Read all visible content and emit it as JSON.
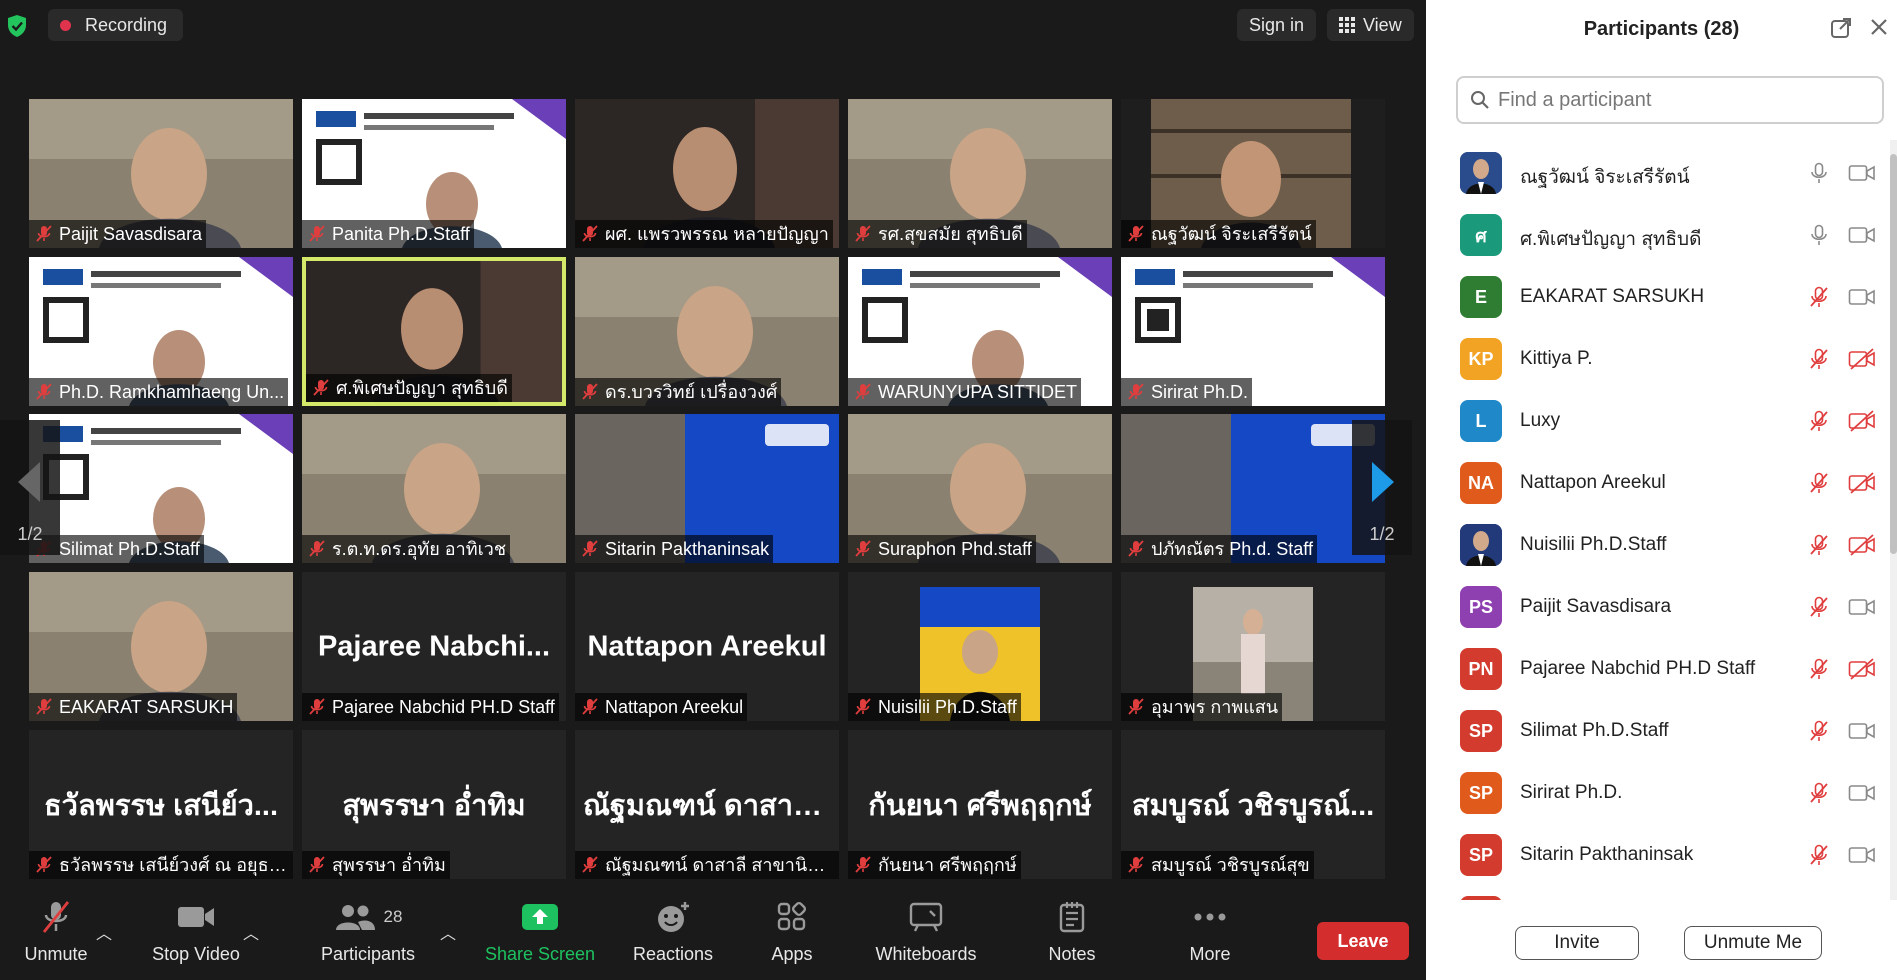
{
  "topbar": {
    "recording": "Recording",
    "sign_in": "Sign in",
    "view": "View"
  },
  "tiles": [
    {
      "name": "Paijit Savasdisara",
      "scene": "person",
      "big": ""
    },
    {
      "name": "Panita Ph.D.Staff",
      "scene": "slide-person",
      "big": ""
    },
    {
      "name": "ผศ. แพรวพรรณ หลายปัญญา",
      "scene": "person-dark",
      "big": ""
    },
    {
      "name": "รศ.สุขสมัย สุทธิบดี",
      "scene": "person",
      "big": ""
    },
    {
      "name": "ณฐวัฒน์ จิระเสรีรัตน์",
      "scene": "bookshelf",
      "big": ""
    },
    {
      "name": "Ph.D. Ramkhamhaeng Un...",
      "scene": "slide-person",
      "big": ""
    },
    {
      "name": "ศ.พิเศษปัญญา สุทธิบดี",
      "scene": "person-dark",
      "big": "",
      "active": true
    },
    {
      "name": "ดร.บวรวิทย์ เปรื่องวงศ์",
      "scene": "person",
      "big": ""
    },
    {
      "name": "WARUNYUPA SITTIDET",
      "scene": "slide-person",
      "big": ""
    },
    {
      "name": "Sirirat Ph.D.",
      "scene": "slide",
      "big": ""
    },
    {
      "name": "Silimat Ph.D.Staff",
      "scene": "slide-person",
      "big": ""
    },
    {
      "name": "ร.ต.ท.ดร.อุทัย อาทิเวช",
      "scene": "person",
      "big": ""
    },
    {
      "name": "Sitarin Pakthaninsak",
      "scene": "phd-blue",
      "big": ""
    },
    {
      "name": "Suraphon Phd.staff",
      "scene": "person",
      "big": ""
    },
    {
      "name": "ปภัทณัตร Ph.d. Staff",
      "scene": "phd-blue",
      "big": ""
    },
    {
      "name": "EAKARAT SARSUKH",
      "scene": "person",
      "big": ""
    },
    {
      "name": "Pajaree Nabchid PH.D Staff",
      "scene": "blank",
      "big": "Pajaree  Nabchi..."
    },
    {
      "name": "Nattapon Areekul",
      "scene": "blank",
      "big": "Nattapon Areekul"
    },
    {
      "name": "Nuisilii Ph.D.Staff",
      "scene": "phd-yellow",
      "big": ""
    },
    {
      "name": "อุมาพร กาพแสน",
      "scene": "photo",
      "big": ""
    },
    {
      "name": "ธวัลพรรษ เสนีย์วงศ์ ณ อยุธยา",
      "scene": "blank",
      "big": "ธวัลพรรษ เสนีย์ว..."
    },
    {
      "name": "สุพรรษา อ่ำทิม",
      "scene": "blank",
      "big": "สุพรรษา อ่ำทิม"
    },
    {
      "name": "ณัฐมณฑน์ ดาสาลี สาขานิติศ...",
      "scene": "blank",
      "big": "ณัฐมณฑน์ ดาสาลี..."
    },
    {
      "name": "กันยนา ศรีพฤฤกษ์",
      "scene": "blank",
      "big": "กันยนา ศรีพฤฤกษ์"
    },
    {
      "name": "สมบูรณ์ วชิรบูรณ์สุข",
      "scene": "blank",
      "big": "สมบูรณ์ วชิรบูรณ์..."
    }
  ],
  "pager": {
    "left": "1/2",
    "right": "1/2"
  },
  "toolbar": {
    "unmute": "Unmute",
    "stop_video": "Stop Video",
    "participants": "Participants",
    "participants_count": "28",
    "share_screen": "Share Screen",
    "reactions": "Reactions",
    "apps": "Apps",
    "whiteboards": "Whiteboards",
    "notes": "Notes",
    "more": "More",
    "leave": "Leave"
  },
  "panel": {
    "title": "Participants (28)",
    "search_placeholder": "Find a participant",
    "invite": "Invite",
    "unmute_me": "Unmute Me",
    "participants": [
      {
        "initials": "",
        "name": "ณฐวัฒน์ จิระเสรีรัตน์",
        "color": "#2b4c8c",
        "photo": true,
        "mic": "on",
        "cam": "on"
      },
      {
        "initials": "ศ",
        "name": "ศ.พิเศษปัญญา สุทธิบดี",
        "color": "#1a9a7a",
        "photo": false,
        "mic": "on",
        "cam": "on"
      },
      {
        "initials": "E",
        "name": "EAKARAT SARSUKH",
        "color": "#2e7d32",
        "photo": false,
        "mic": "muted",
        "cam": "on"
      },
      {
        "initials": "KP",
        "name": "Kittiya P.",
        "color": "#f2a324",
        "photo": false,
        "mic": "muted",
        "cam": "off"
      },
      {
        "initials": "L",
        "name": "Luxy",
        "color": "#1e88c9",
        "photo": false,
        "mic": "muted",
        "cam": "off"
      },
      {
        "initials": "NA",
        "name": "Nattapon Areekul",
        "color": "#e05a1c",
        "photo": false,
        "mic": "muted",
        "cam": "off"
      },
      {
        "initials": "",
        "name": "Nuisilii Ph.D.Staff",
        "color": "#233a7a",
        "photo": true,
        "mic": "muted",
        "cam": "off"
      },
      {
        "initials": "PS",
        "name": "Paijit Savasdisara",
        "color": "#8e3fb0",
        "photo": false,
        "mic": "muted",
        "cam": "on"
      },
      {
        "initials": "PN",
        "name": "Pajaree Nabchid PH.D Staff",
        "color": "#d23b2e",
        "photo": false,
        "mic": "muted",
        "cam": "off"
      },
      {
        "initials": "SP",
        "name": "Silimat Ph.D.Staff",
        "color": "#d23b2e",
        "photo": false,
        "mic": "muted",
        "cam": "on"
      },
      {
        "initials": "SP",
        "name": "Sirirat Ph.D.",
        "color": "#e05a1c",
        "photo": false,
        "mic": "muted",
        "cam": "on"
      },
      {
        "initials": "SP",
        "name": "Sitarin Pakthaninsak",
        "color": "#d23b2e",
        "photo": false,
        "mic": "muted",
        "cam": "on"
      }
    ]
  },
  "colors": {
    "accent": "#0e72ed",
    "share_green": "#1ec15f",
    "muted_red": "#e03e3e",
    "leave_red": "#d42d2d",
    "active_border": "#d4e86a"
  }
}
